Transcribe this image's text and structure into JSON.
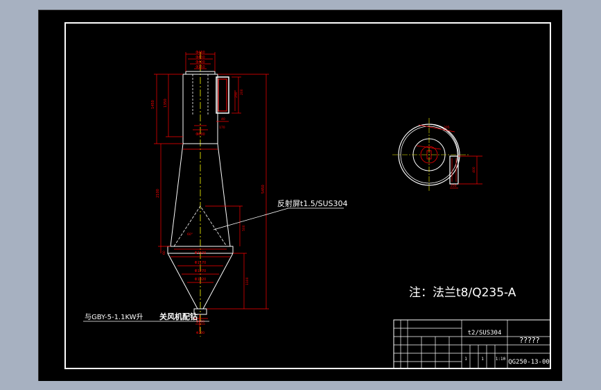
{
  "background_color": "#a7b1c1",
  "canvas_color": "#000000",
  "line_colors": {
    "outline": "#ffffff",
    "dimension": "#ff0000",
    "centerline": "#ffff00"
  },
  "drawing": {
    "callout_reflector": "反射屏t1.5/SUS304",
    "note_connection_prefix": "与GBY-5-1.1KW升",
    "note_connection_bold": "关风机配钻",
    "note_main": "注：法兰t8/Q235-A"
  },
  "dimensions": {
    "top_1": "Φ460",
    "top_2": "Φ430",
    "top_3": "Φ400",
    "top_4": "Φ150",
    "height_1": "1450",
    "height_2": "1350",
    "height_3": "2100",
    "height_total": "5450",
    "inlet_1": "200",
    "inlet_2": "250",
    "inlet_3": "40",
    "inlet_4": "170",
    "mid_1": "Φ800",
    "lower_1": "Φ1100",
    "lower_2": "Φ1170",
    "lower_3": "Φ1270",
    "lower_4": "Φ1020",
    "cone_h": "1100",
    "reflector_h": "500",
    "angle": "60°",
    "skirt": "60",
    "bottom_1": "Φ300",
    "bottom_2": "Φ200",
    "plan_1": "400",
    "plan_2": "250",
    "plan_3": "205"
  },
  "title_block": {
    "material": "t2/SUS304",
    "name": "?????",
    "code": "QG250-13-00",
    "scale": "1:10",
    "qty_a": "1",
    "qty_b": "1"
  }
}
